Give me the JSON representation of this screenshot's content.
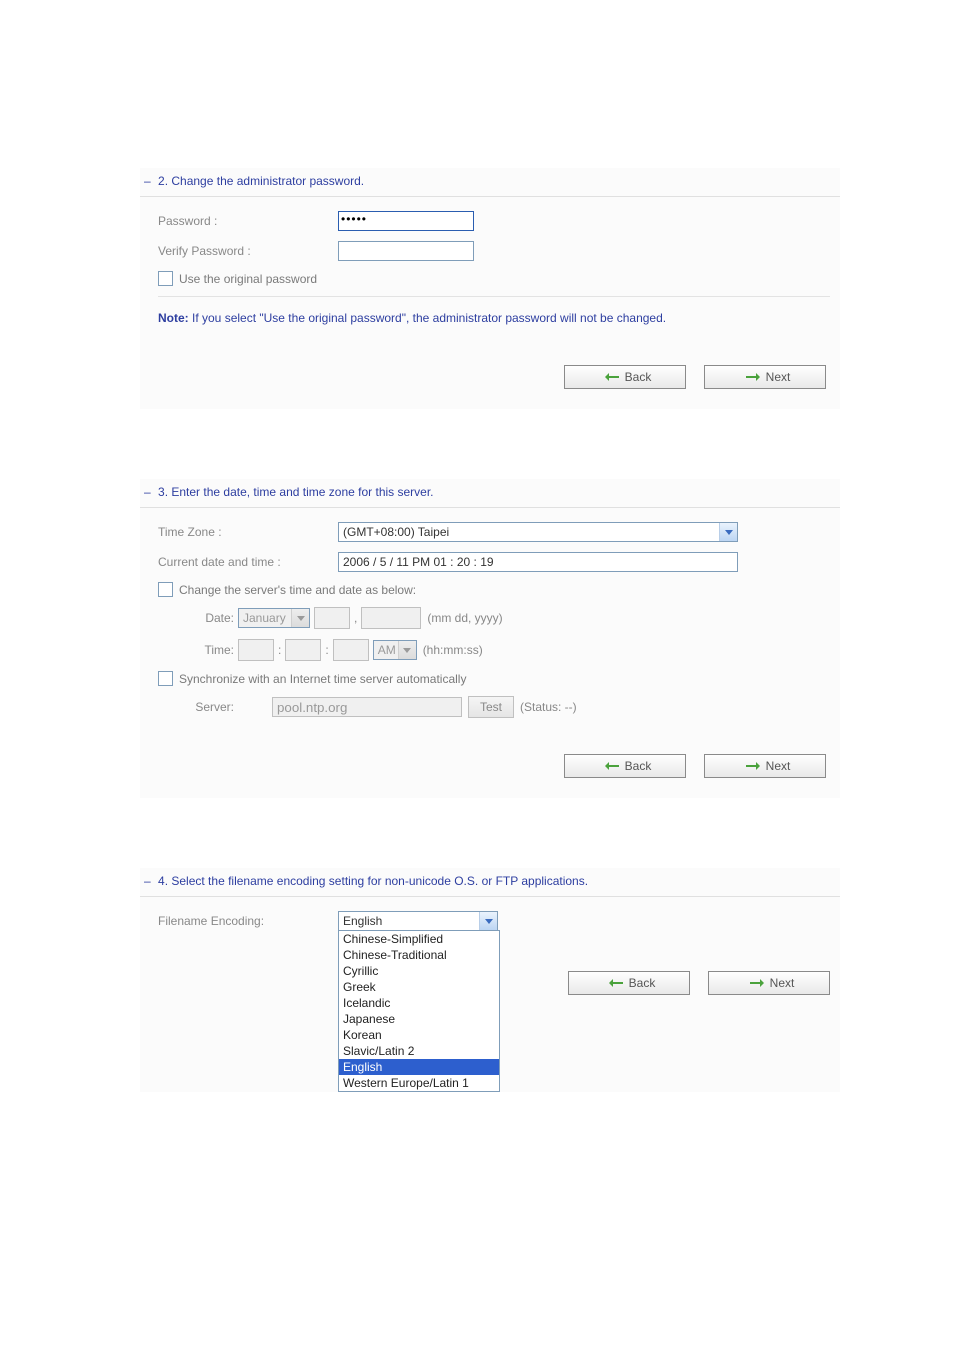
{
  "panel2": {
    "title": "2. Change the administrator password.",
    "password_label": "Password :",
    "verify_label": "Verify Password :",
    "password_value": "•••••",
    "verify_value": "",
    "use_original_label": "Use the original password",
    "note_label": "Note:",
    "note_text": " If you select \"Use the original password\", the administrator password will not be changed.",
    "back": "Back",
    "next": "Next"
  },
  "panel3": {
    "title": "3. Enter the date, time and time zone for this server.",
    "tz_label": "Time Zone :",
    "tz_value": "(GMT+08:00) Taipei",
    "current_label": "Current date and time :",
    "current_value": "2006 / 5 / 11 PM 01 : 20 : 19",
    "change_label": "Change the server's time and date as below:",
    "date_label": "Date:",
    "month_value": "January",
    "date_hint": "(mm dd, yyyy)",
    "time_label": "Time:",
    "ampm_value": "AM",
    "time_hint": "(hh:mm:ss)",
    "sync_label": "Synchronize with an Internet time server automatically",
    "server_label": "Server:",
    "server_value": "pool.ntp.org",
    "test_label": "Test",
    "status_label": "(Status: --)",
    "back": "Back",
    "next": "Next"
  },
  "panel4": {
    "title": "4. Select the filename encoding setting for non-unicode O.S. or FTP applications.",
    "encoding_label": "Filename Encoding:",
    "encoding_value": "English",
    "options": [
      "Chinese-Simplified",
      "Chinese-Traditional",
      "Cyrillic",
      "Greek",
      "Icelandic",
      "Japanese",
      "Korean",
      "Slavic/Latin 2",
      "English",
      "Western Europe/Latin 1"
    ],
    "selected_option": "English",
    "back": "Back",
    "next": "Next"
  }
}
